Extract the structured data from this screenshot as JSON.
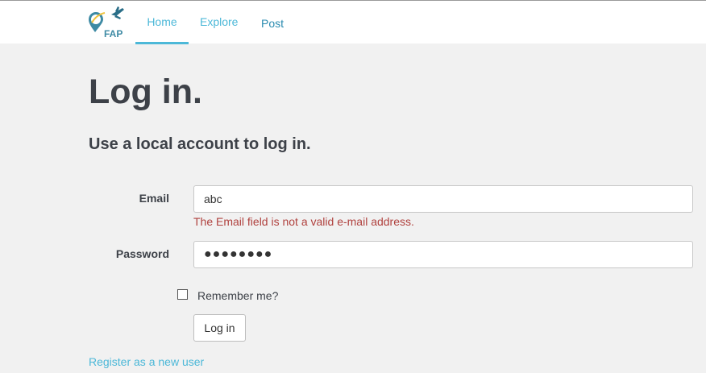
{
  "nav": {
    "logo_text": "FAP",
    "items": [
      {
        "label": "Home"
      },
      {
        "label": "Explore"
      },
      {
        "label": "Post"
      }
    ]
  },
  "page": {
    "title": "Log in.",
    "subtitle": "Use a local account to log in."
  },
  "form": {
    "email_label": "Email",
    "email_value": "abc",
    "email_error": "The Email field is not a valid e-mail address.",
    "password_label": "Password",
    "password_value": "●●●●●●●●",
    "remember_label": "Remember me?",
    "remember_checked": false,
    "submit_label": "Log in"
  },
  "links": {
    "register": "Register as a new user"
  },
  "colors": {
    "accent": "#4cb8d8",
    "error": "#b0413e",
    "background": "#f1f1f1"
  },
  "icons": [
    "location-pin-icon",
    "airplane-icon"
  ]
}
